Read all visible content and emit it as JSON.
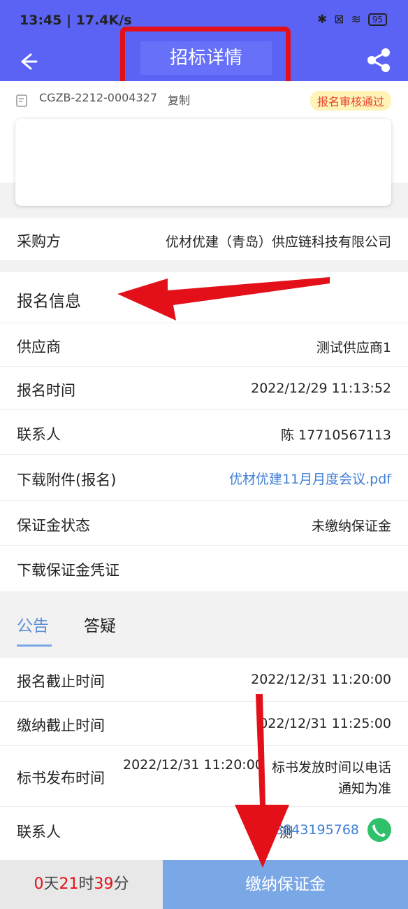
{
  "status": {
    "time": "13:45 | 17.4K/s",
    "battery": "95"
  },
  "nav": {
    "title": "招标详情"
  },
  "header": {
    "code": "CGZB-2212-0004327",
    "copy": "复制",
    "badge": "报名审核通过"
  },
  "purchaser": {
    "label": "采购方",
    "value": "优材优建（青岛）供应链科技有限公司"
  },
  "signup": {
    "title": "报名信息",
    "rows": [
      {
        "label": "供应商",
        "value": "测试供应商1"
      },
      {
        "label": "报名时间",
        "value": "2022/12/29 11:13:52"
      },
      {
        "label": "联系人",
        "value": "陈 17710567113"
      },
      {
        "label": "下载附件(报名)",
        "value": "优材优建11月月度会议.pdf"
      },
      {
        "label": "保证金状态",
        "value": "未缴纳保证金"
      },
      {
        "label": "下载保证金凭证",
        "value": ""
      }
    ]
  },
  "tabs": {
    "active": "公告",
    "other": "答疑"
  },
  "announce": {
    "rows": [
      {
        "label": "报名截止时间",
        "value": "2022/12/31 11:20:00"
      },
      {
        "label": "缴纳截止时间",
        "value": "022/12/31 11:25:00"
      },
      {
        "label": "标书发布时间",
        "value_line1": "2022/12/31 11:20:00",
        "value_line1b": "标书发放时间以电话",
        "value_line2": "通知为准"
      },
      {
        "label": "联系人",
        "value_prefix": "测",
        "value": "8843195768"
      }
    ]
  },
  "footer": {
    "days": "0",
    "d": "天",
    "hours": "21",
    "h": "时",
    "mins": "39",
    "m": "分",
    "pay": "缴纳保证金"
  },
  "colors": {
    "brand": "#5b63f5",
    "annotation": "#e3101a",
    "link": "#3f7fd6",
    "pay": "#7aa7e6"
  }
}
